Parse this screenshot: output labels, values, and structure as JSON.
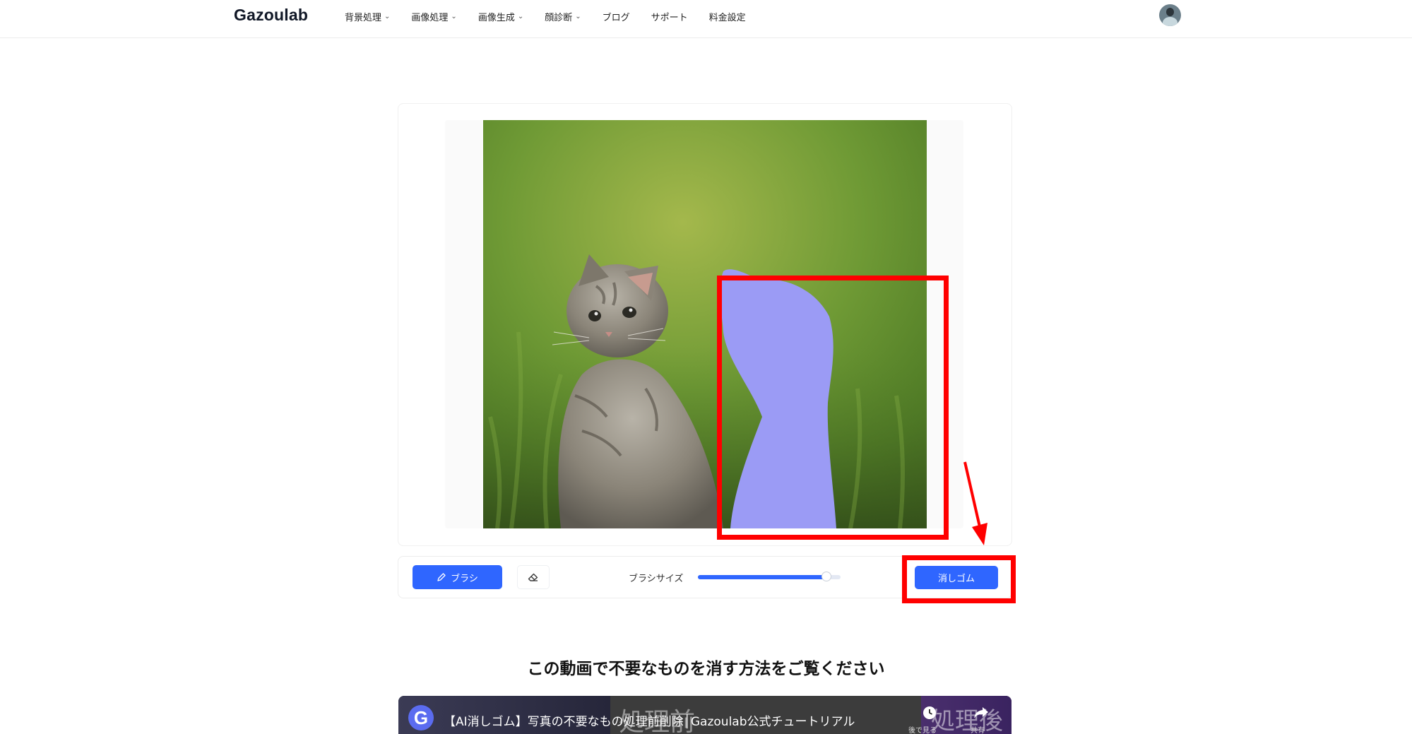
{
  "header": {
    "logo": "Gazoulab",
    "nav": [
      {
        "label": "背景処理",
        "has_dropdown": true
      },
      {
        "label": "画像処理",
        "has_dropdown": true
      },
      {
        "label": "画像生成",
        "has_dropdown": true
      },
      {
        "label": "顔診断",
        "has_dropdown": true
      },
      {
        "label": "ブログ",
        "has_dropdown": false
      },
      {
        "label": "サポート",
        "has_dropdown": false
      },
      {
        "label": "料金設定",
        "has_dropdown": false
      }
    ],
    "chevron": "⌄"
  },
  "editor": {
    "mask_color": "#9b9bf5",
    "highlight_color": "#ff0000"
  },
  "toolbar": {
    "brush_label": "ブラシ",
    "brush_size_label": "ブラシサイズ",
    "brush_size_fraction": 0.93,
    "erase_label": "消しゴム",
    "accent": "#2f66ff"
  },
  "video_section": {
    "heading": "この動画で不要なものを消す方法をご覧ください",
    "logo_letter": "G",
    "video_title": "【AI消しゴム】写真の不要なもの処理前削除│Gazoulab公式チュートリアル",
    "overlay_before": "処理前",
    "overlay_after": "処理後",
    "watch_later": "後で見る",
    "share": "共有"
  }
}
